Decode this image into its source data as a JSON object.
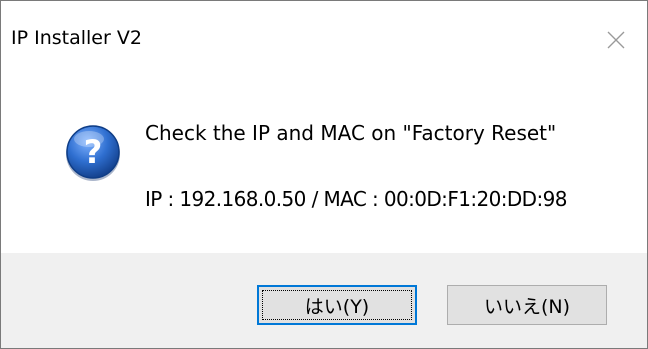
{
  "window": {
    "title": "IP Installer V2"
  },
  "icons": {
    "close": "close-icon",
    "question": "question-icon"
  },
  "message": {
    "line1": "Check the IP and MAC on \"Factory Reset\"",
    "line2": "IP : 192.168.0.50 / MAC : 00:0D:F1:20:DD:98"
  },
  "buttons": {
    "yes_label": "はい(Y)",
    "no_label": "いいえ(N)"
  },
  "colors": {
    "accent_focus": "#0078d7",
    "button_bar": "#f0f0f0",
    "icon_blue": "#1f5fb4"
  }
}
